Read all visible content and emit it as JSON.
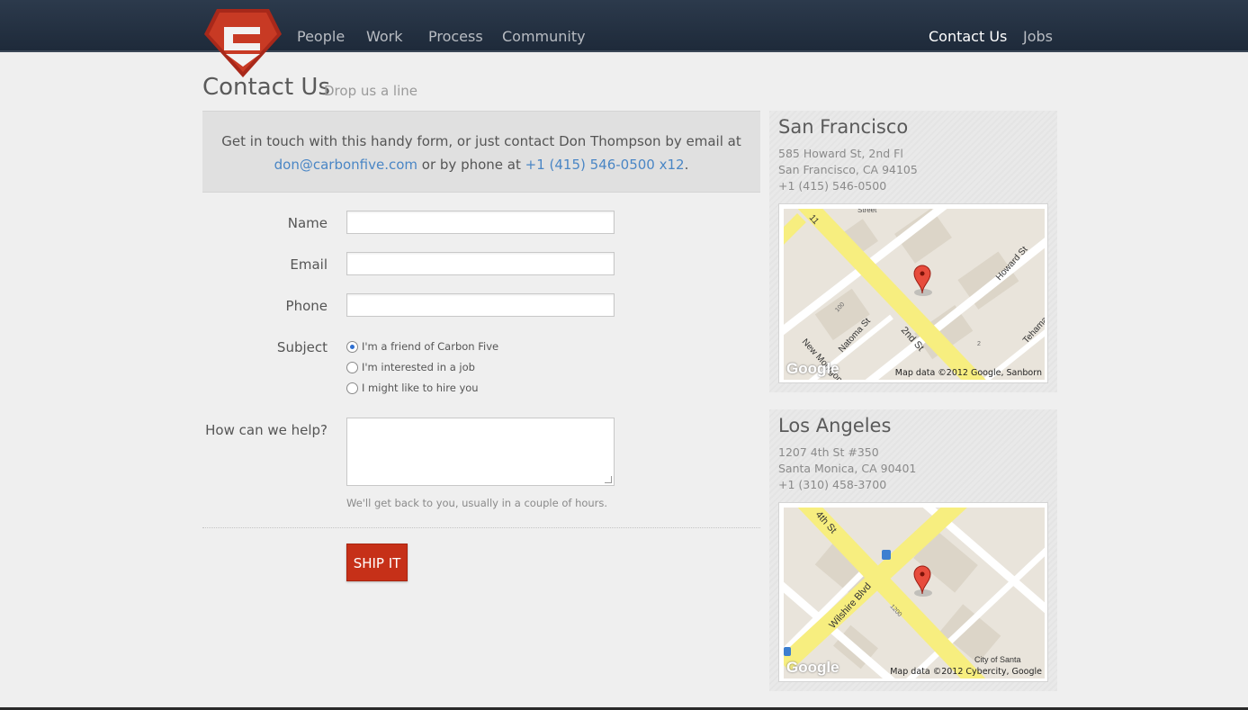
{
  "nav": {
    "left": [
      "People",
      "Work",
      "Process",
      "Community"
    ],
    "right": [
      "Contact Us",
      "Jobs"
    ],
    "active": "Contact Us"
  },
  "header": {
    "title": "Contact Us",
    "subtitle": "Drop us a line"
  },
  "intro": {
    "text_before": "Get in touch with this handy form, or just contact Don Thompson by email at",
    "email": "don@carbonfive.com",
    "text_middle": "or by phone at",
    "phone": "+1 (415) 546-0500 x12",
    "text_after": "."
  },
  "form": {
    "name_label": "Name",
    "email_label": "Email",
    "phone_label": "Phone",
    "subject_label": "Subject",
    "subject_options": [
      "I'm a friend of Carbon Five",
      "I'm interested in a job",
      "I might like to hire you"
    ],
    "subject_selected": "I'm a friend of Carbon Five",
    "help_label": "How can we help?",
    "hint": "We'll get back to you, usually in a couple of hours.",
    "submit_label": "SHIP IT"
  },
  "offices": [
    {
      "city": "San Francisco",
      "address1": "585 Howard St, 2nd Fl",
      "address2": "San Francisco, CA 94105",
      "phone": "+1 (415) 546-0500",
      "map_credit": "Map data ©2012 Google, Sanborn",
      "map_logo": "Google",
      "street_labels": [
        "2nd St",
        "Howard St",
        "Natoma St",
        "New Montgomery St",
        "Tehama",
        "Street",
        "11",
        "100",
        "2"
      ]
    },
    {
      "city": "Los Angeles",
      "address1": "1207 4th St #350",
      "address2": "Santa Monica, CA 90401",
      "phone": "+1 (310) 458-3700",
      "map_credit": "Map data ©2012 Cybercity, Google",
      "map_logo": "Google",
      "street_labels": [
        "4th St",
        "Wilshire Blvd",
        "1200",
        "City of Santa"
      ]
    }
  ],
  "colors": {
    "accent": "#c63018",
    "link": "#4a86c5",
    "navbar": "#243244"
  }
}
